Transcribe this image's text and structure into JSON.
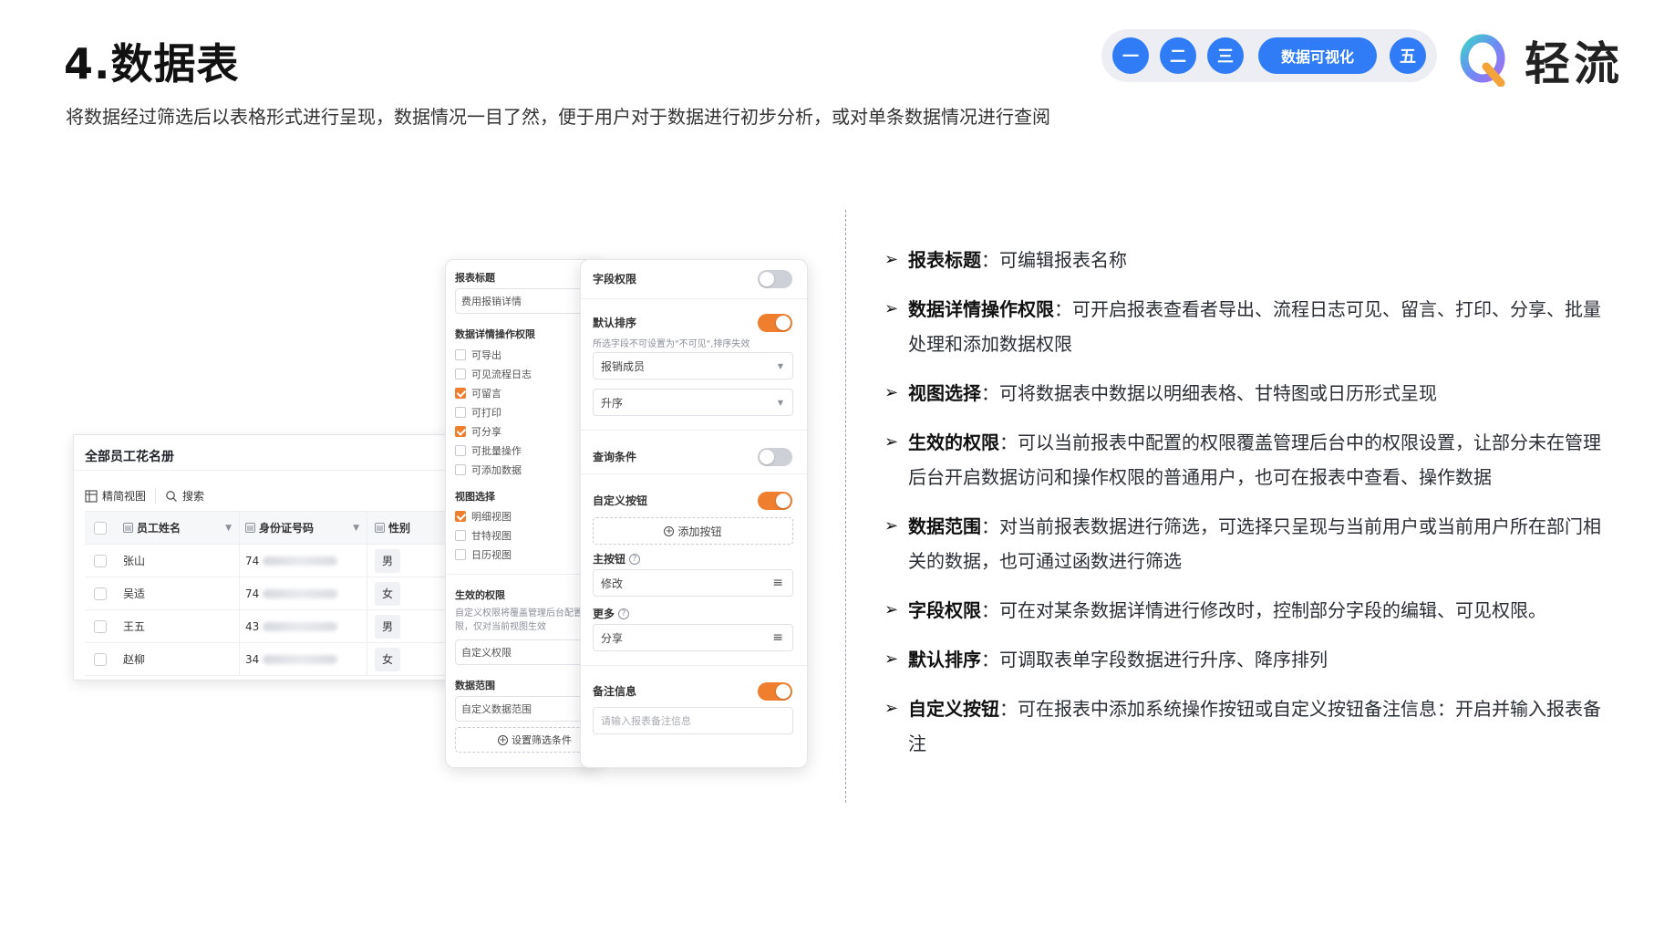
{
  "header": {
    "title": "4.数据表",
    "subtitle": "将数据经过筛选后以表格形式进行呈现，数据情况一目了然，便于用户对于数据进行初步分析，或对单条数据情况进行查阅",
    "nav": [
      "一",
      "二",
      "三",
      "数据可视化",
      "五"
    ],
    "brand": "轻流",
    "colors": {
      "nav_bg": "#eceef3",
      "nav_active": "#2f7cf6",
      "accent": "#ef7f2e"
    }
  },
  "table": {
    "title": "全部员工花名册",
    "view_label": "精简视图",
    "search_label": "搜索",
    "columns": [
      "员工姓名",
      "身份证号码",
      "性别"
    ],
    "rows": [
      {
        "name": "张山",
        "id_prefix": "74",
        "sex": "男"
      },
      {
        "name": "吴适",
        "id_prefix": "74",
        "sex": "女"
      },
      {
        "name": "王五",
        "id_prefix": "43",
        "sex": "男"
      },
      {
        "name": "赵柳",
        "id_prefix": "34",
        "sex": "女"
      }
    ]
  },
  "config_left": {
    "report_title_label": "报表标题",
    "report_title_value": "费用报销详情",
    "detail_perm_label": "数据详情操作权限",
    "detail_perms": [
      {
        "label": "可导出",
        "checked": false
      },
      {
        "label": "可见流程日志",
        "checked": false
      },
      {
        "label": "可留言",
        "checked": true
      },
      {
        "label": "可打印",
        "checked": false
      },
      {
        "label": "可分享",
        "checked": true
      },
      {
        "label": "可批量操作",
        "checked": false
      },
      {
        "label": "可添加数据",
        "checked": false
      }
    ],
    "view_label": "视图选择",
    "views": [
      {
        "label": "明细视图",
        "checked": true
      },
      {
        "label": "甘特视图",
        "checked": false
      },
      {
        "label": "日历视图",
        "checked": false
      }
    ],
    "effective_perm_label": "生效的权限",
    "effective_perm_note": "自定义权限将覆盖管理后台配置权限，仅对当前视图生效",
    "effective_perm_value": "自定义权限",
    "data_scope_label": "数据范围",
    "data_scope_value": "自定义数据范围",
    "set_filter_label": "设置筛选条件"
  },
  "config_right": {
    "field_perm_label": "字段权限",
    "field_perm_on": false,
    "default_sort_label": "默认排序",
    "default_sort_on": true,
    "default_sort_note": "所选字段不可设置为\"不可见\",排序失效",
    "sort_field": "报销成员",
    "sort_order": "升序",
    "query_label": "查询条件",
    "query_on": false,
    "custom_btn_label": "自定义按钮",
    "custom_btn_on": true,
    "add_btn_label": "添加按钮",
    "main_btn_label": "主按钮",
    "main_btn_value": "修改",
    "more_label": "更多",
    "more_value": "分享",
    "remark_label": "备注信息",
    "remark_on": true,
    "remark_placeholder": "请输入报表备注信息"
  },
  "descriptions": [
    {
      "key": "报表标题",
      "text": "可编辑报表名称"
    },
    {
      "key": "数据详情操作权限",
      "text": "可开启报表查看者导出、流程日志可见、留言、打印、分享、批量处理和添加数据权限"
    },
    {
      "key": "视图选择",
      "text": "可将数据表中数据以明细表格、甘特图或日历形式呈现"
    },
    {
      "key": "生效的权限",
      "text": "可以当前报表中配置的权限覆盖管理后台中的权限设置，让部分未在管理后台开启数据访问和操作权限的普通用户，也可在报表中查看、操作数据"
    },
    {
      "key": "数据范围",
      "text": "对当前报表数据进行筛选，可选择只呈现与当前用户或当前用户所在部门相关的数据，也可通过函数进行筛选"
    },
    {
      "key": "字段权限",
      "text": "可在对某条数据详情进行修改时，控制部分字段的编辑、可见权限。"
    },
    {
      "key": "默认排序",
      "text": "可调取表单字段数据进行升序、降序排列"
    },
    {
      "key": "自定义按钮",
      "text": "可在报表中添加系统操作按钮或自定义按钮备注信息：开启并输入报表备注"
    }
  ]
}
